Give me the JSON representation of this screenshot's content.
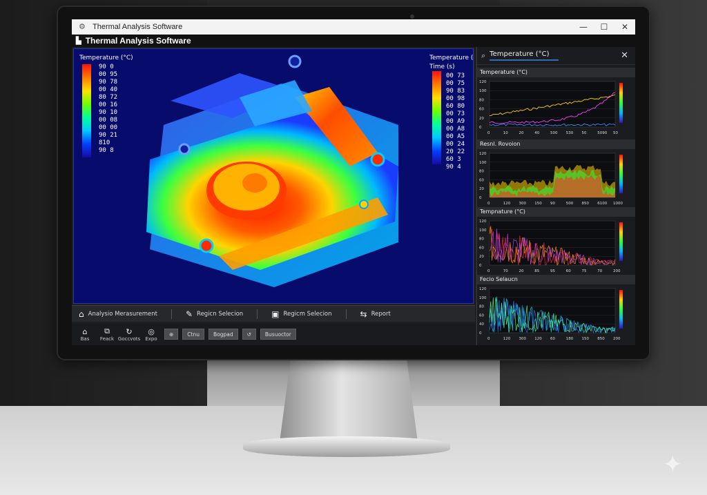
{
  "window": {
    "title": "Thermal Analysis Software",
    "app_header": "Thermal Analysis Software",
    "controls": {
      "minimize": "—",
      "maximize": "☐",
      "close": "✕"
    }
  },
  "viewport": {
    "scale_left": {
      "header": "Temperature (°C)",
      "labels": [
        "90 0",
        "00 95",
        "90 78",
        "00 40",
        "80 72",
        "00 16",
        "90 10",
        "00 08",
        "00 00",
        "90 21",
        "810",
        "90 8"
      ]
    },
    "scale_right": {
      "header": "Temperature (°C",
      "subheader": "Time (s)",
      "labels": [
        "00 73",
        "00 75",
        "90 83",
        "00 98",
        "60 80",
        "00 73",
        "00 A9",
        "00 A8",
        "00 A5",
        "00 24",
        "20 22",
        "60 3",
        "90 4"
      ]
    }
  },
  "toolbar": {
    "items": [
      {
        "icon": "measure-icon",
        "glyph": "⌂",
        "label": "Analysio Merasurement"
      },
      {
        "icon": "pen-icon",
        "glyph": "✎",
        "label": "Regicn Selecion"
      },
      {
        "icon": "region-icon",
        "glyph": "▣",
        "label": "Regicm Selecion"
      },
      {
        "icon": "report-icon",
        "glyph": "⇆",
        "label": "Report"
      }
    ]
  },
  "toolbar2": {
    "items": [
      {
        "icon": "home-icon",
        "glyph": "⌂",
        "label": "Bas"
      },
      {
        "icon": "layers-icon",
        "glyph": "⧉",
        "label": "Feack"
      },
      {
        "icon": "refresh-icon",
        "glyph": "↻",
        "label": "Goccvots"
      },
      {
        "icon": "export-icon",
        "glyph": "◎",
        "label": "Expo"
      }
    ],
    "buttons": [
      "⊕",
      "Ctnu",
      "Bogpad",
      "↺",
      "Busuoctor"
    ]
  },
  "panel": {
    "search_label": "Temperature (°C)",
    "close": "✕",
    "charts": [
      {
        "title": "Temperature (°C)",
        "y_ticks": [
          "120",
          "100",
          "80",
          "60",
          "20",
          "0"
        ],
        "x_ticks": [
          "0",
          "10",
          "20",
          "40",
          "500",
          "530",
          "50",
          "5090",
          "50"
        ]
      },
      {
        "title": "Resnl. Rovoion",
        "y_ticks": [
          "120",
          "100",
          "80",
          "60",
          "20",
          "0"
        ],
        "x_ticks": [
          "0",
          "120",
          "300",
          "150",
          "90",
          "500",
          "850",
          "6100",
          "1000"
        ]
      },
      {
        "title": "Tempnature (°C)",
        "y_ticks": [
          "120",
          "100",
          "80",
          "60",
          "20",
          "0"
        ],
        "x_ticks": [
          "0",
          "70",
          "20",
          "85",
          "95",
          "60",
          "75",
          "70",
          "200"
        ]
      },
      {
        "title": "Fecio Selaucn",
        "y_ticks": [
          "120",
          "100",
          "80",
          "60",
          "40",
          "0"
        ],
        "x_ticks": [
          "0",
          "120",
          "300",
          "120",
          "60",
          "180",
          "150",
          "850",
          "200"
        ]
      }
    ]
  },
  "colors": {
    "accent": "#2f6fb5",
    "thermal_background": "#070b6b"
  }
}
